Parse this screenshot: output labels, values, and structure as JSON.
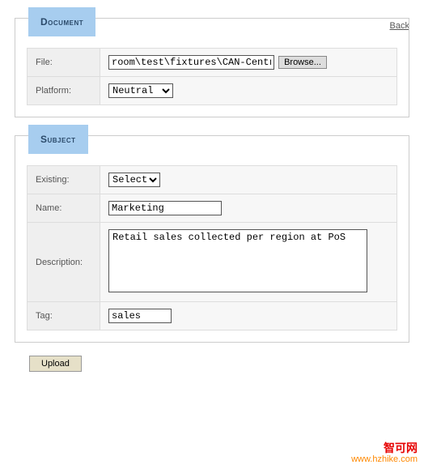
{
  "back_label": "Back",
  "document": {
    "legend": "Document",
    "file_label": "File:",
    "file_value": "room\\test\\fixtures\\CAN-Central.xml",
    "browse_label": "Browse...",
    "platform_label": "Platform:",
    "platform_value": "Neutral",
    "platform_options": [
      "Neutral"
    ]
  },
  "subject": {
    "legend": "Subject",
    "existing_label": "Existing:",
    "existing_value": "Select",
    "existing_options": [
      "Select"
    ],
    "name_label": "Name:",
    "name_value": "Marketing",
    "description_label": "Description:",
    "description_value": "Retail sales collected per region at PoS",
    "tag_label": "Tag:",
    "tag_value": "sales"
  },
  "upload_label": "Upload",
  "watermark": {
    "line1": "智可网",
    "line2": "www.hzhike.com"
  }
}
